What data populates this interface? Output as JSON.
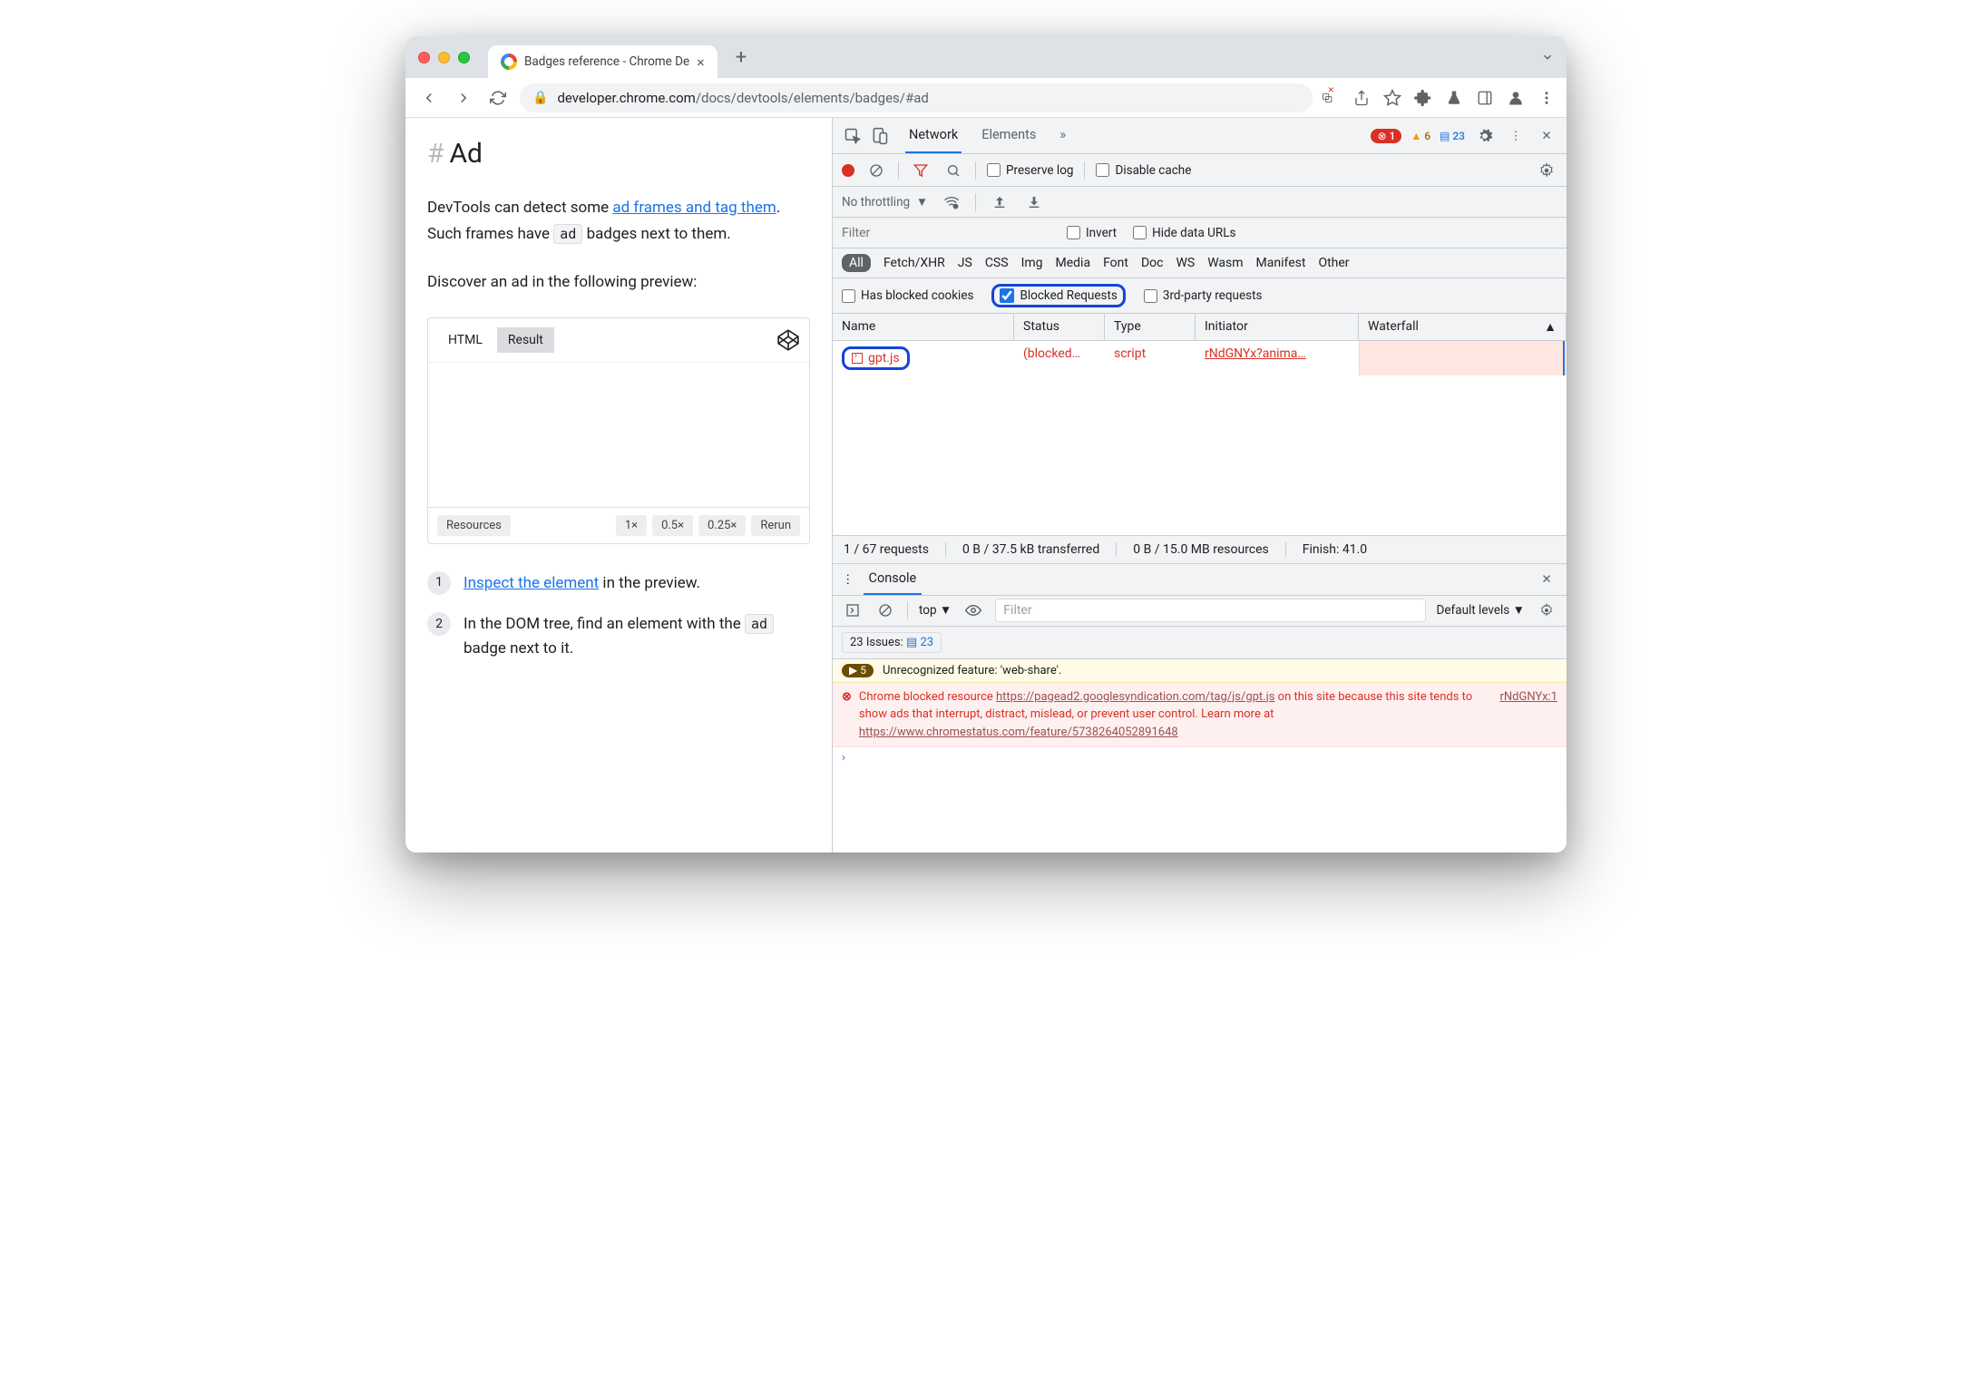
{
  "browser": {
    "tab_title": "Badges reference - Chrome De",
    "url_host": "developer.chrome.com",
    "url_path": "/docs/devtools/elements/badges/#ad"
  },
  "page": {
    "heading": "Ad",
    "para1_a": "DevTools can detect some ",
    "para1_link": "ad frames and tag them",
    "para1_b": ". Such frames have ",
    "para1_badge": "ad",
    "para1_c": " badges next to them.",
    "para2": "Discover an ad in the following preview:",
    "embed": {
      "tab_html": "HTML",
      "tab_result": "Result",
      "footer": {
        "resources": "Resources",
        "z1": "1×",
        "z05": "0.5×",
        "z025": "0.25×",
        "rerun": "Rerun"
      }
    },
    "steps": {
      "s1a": "Inspect the element",
      "s1b": " in the preview.",
      "s2a": "In the DOM tree, find an element with the ",
      "s2badge": "ad",
      "s2b": " badge next to it."
    }
  },
  "devtools": {
    "tabs": {
      "network": "Network",
      "elements": "Elements"
    },
    "counts": {
      "err": "1",
      "warn": "6",
      "info": "23"
    },
    "nettoolbar": {
      "preserve": "Preserve log",
      "disable": "Disable cache"
    },
    "throttle": "No throttling",
    "filter_placeholder": "Filter",
    "filter_opts": {
      "invert": "Invert",
      "hide": "Hide data URLs"
    },
    "types": [
      "All",
      "Fetch/XHR",
      "JS",
      "CSS",
      "Img",
      "Media",
      "Font",
      "Doc",
      "WS",
      "Wasm",
      "Manifest",
      "Other"
    ],
    "checks": {
      "blocked_cookies": "Has blocked cookies",
      "blocked_req": "Blocked Requests",
      "third": "3rd-party requests"
    },
    "columns": {
      "name": "Name",
      "status": "Status",
      "type": "Type",
      "initiator": "Initiator",
      "waterfall": "Waterfall"
    },
    "row": {
      "name": "gpt.js",
      "status": "(blocked…",
      "type": "script",
      "initiator": "rNdGNYx?anima…"
    },
    "summary": {
      "req": "1 / 67 requests",
      "transfer": "0 B / 37.5 kB transferred",
      "res": "0 B / 15.0 MB resources",
      "finish": "Finish: 41.0"
    },
    "console": {
      "title": "Console",
      "context": "top",
      "filter": "Filter",
      "levels": "Default levels",
      "issues_label": "23 Issues:",
      "issues_count": "23",
      "warn_count": "5",
      "warn_text": "Unrecognized feature: 'web-share'.",
      "err_a": "Chrome blocked resource ",
      "err_url1": "https://pagead2.googlesyndication.com/tag/js/gpt.js",
      "err_b": " on this site because this site tends to show ads that interrupt, distract, mislead, or prevent user control. Learn more at ",
      "err_url2": "https://www.chromestatus.com/feature/5738264052891648",
      "err_src": "rNdGNYx:1"
    }
  }
}
